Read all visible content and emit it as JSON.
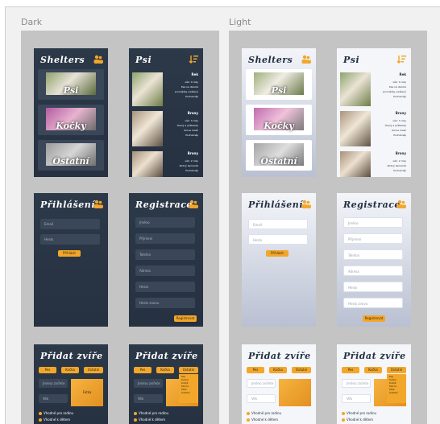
{
  "frames": {
    "dark_label": "Dark",
    "light_label": "Light"
  },
  "colors": {
    "accent": "#f2a72b",
    "dark_bg": "#2d3a4b",
    "light_bg": "#f4f6f9",
    "frame_bg": "#c4c4c4"
  },
  "icons": {
    "shelters": "people-icon",
    "pets": "sort-icon",
    "login": "people-icon",
    "register": "people-icon"
  },
  "shelters": {
    "title": "Shelters",
    "cards": [
      "Psi",
      "Kočky",
      "Ostatní"
    ]
  },
  "pets": {
    "title": "Psi",
    "items": [
      {
        "name": "Rek",
        "lines": [
          "věk: 4 roky",
          "Pes na dlouhé",
          "procházky nadšený",
          "Podrobněji"
        ]
      },
      {
        "name": "Brony",
        "lines": [
          "věk: 3 roky",
          "Hravý a přátelský",
          "rád se mazlí",
          "Podrobněji"
        ]
      },
      {
        "name": "Brony",
        "lines": [
          "věk: 2 roky",
          "Klidný kamarád",
          "Podrobněji"
        ]
      }
    ]
  },
  "login": {
    "title": "Přihlášení",
    "fields": [
      "Email",
      "Heslo"
    ],
    "button": "Přihlásit"
  },
  "register": {
    "title": "Registrace",
    "fields": [
      "Jméno",
      "Příjmení",
      "Telefon",
      "Adresa",
      "Heslo",
      "Heslo znovu"
    ],
    "button": "Registrovat"
  },
  "add_pet": {
    "title": "Přidat zvíře",
    "tabs": [
      "Pes",
      "Kočka",
      "Ostatní"
    ],
    "name_field": "Jméno zvířete",
    "age_field": "Věk",
    "photo_label": "Fotka",
    "options": [
      "Vhodné pro rodinu",
      "Vhodné k dětem"
    ],
    "dropdown": [
      "Pes",
      "Kočka",
      "Králík",
      "Morče",
      "Pták",
      "Ostatní"
    ]
  }
}
